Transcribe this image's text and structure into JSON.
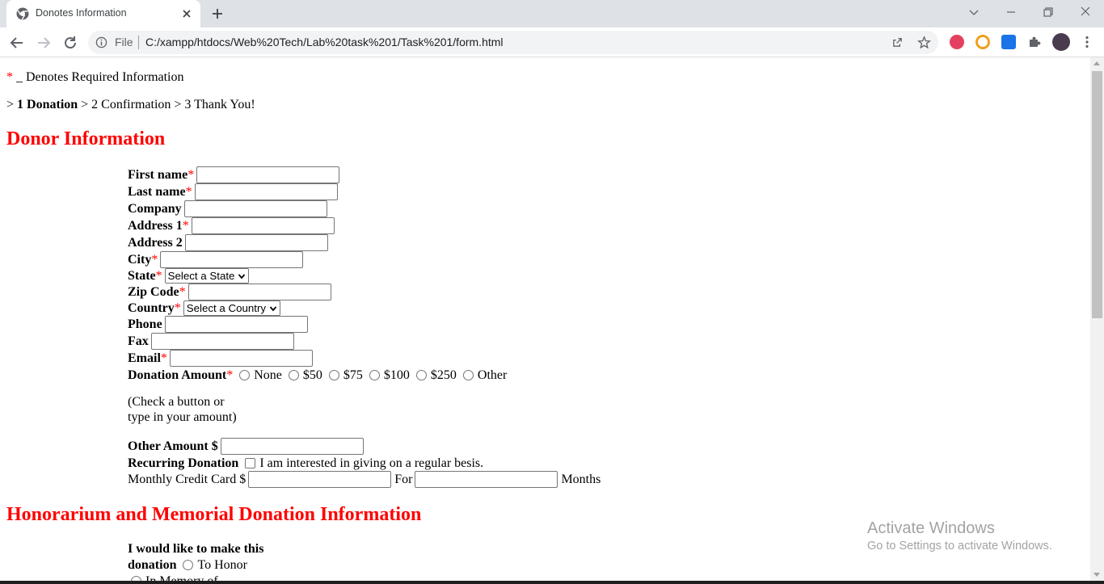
{
  "browser": {
    "tab_title": "Donotes Information",
    "omnibox_scheme": "File",
    "url": "C:/xampp/htdocs/Web%20Tech/Lab%20task%201/Task%201/form.html"
  },
  "page": {
    "required_note_star": "*",
    "required_note": " _ Denotes Required Information",
    "steps": {
      "prefix": "> ",
      "step1": "1 Donation",
      "rest": " > 2 Confirmation > 3 Thank You!"
    },
    "donor_heading": "Donor Information",
    "req_star": "*",
    "fields": {
      "first_name": "First name",
      "last_name": "Last name",
      "company": "Company",
      "address1": "Address 1",
      "address2": "Address 2",
      "city": "City",
      "state": "State",
      "state_select": "Select a State",
      "zip": "Zip Code",
      "country": "Country",
      "country_select": "Select a Country",
      "phone": "Phone",
      "fax": "Fax",
      "email": "Email"
    },
    "donation_amount_label": "Donation Amount",
    "amount_options": [
      "None",
      "$50",
      "$75",
      "$100",
      "$250",
      "Other"
    ],
    "check_hint_line1": "(Check a button or",
    "check_hint_line2": "type in your amount)",
    "other_amount_label": "Other Amount $",
    "recurring_label": "Recurring Donation",
    "recurring_text": "I am interested in giving on a regular besis.",
    "monthly_label": "Monthly Credit Card $",
    "for_label": "For",
    "months_label": "Months",
    "honor_heading": "Honorarium and Memorial Donation Information",
    "honor_label_line1": "I would like to make this",
    "honor_label_line2": "donation",
    "to_honor": "To Honor",
    "in_memory": "In Memory of"
  },
  "watermark": {
    "title": "Activate Windows",
    "subtitle": "Go to Settings to activate Windows."
  },
  "icons": [
    "chrome-favicon",
    "close-icon",
    "plus-icon",
    "minimize-icon",
    "restore-icon",
    "back-icon",
    "forward-icon",
    "reload-icon",
    "info-icon",
    "share-icon",
    "star-icon",
    "extension-icons",
    "puzzle-icon",
    "avatar",
    "kebab-menu-icon"
  ]
}
